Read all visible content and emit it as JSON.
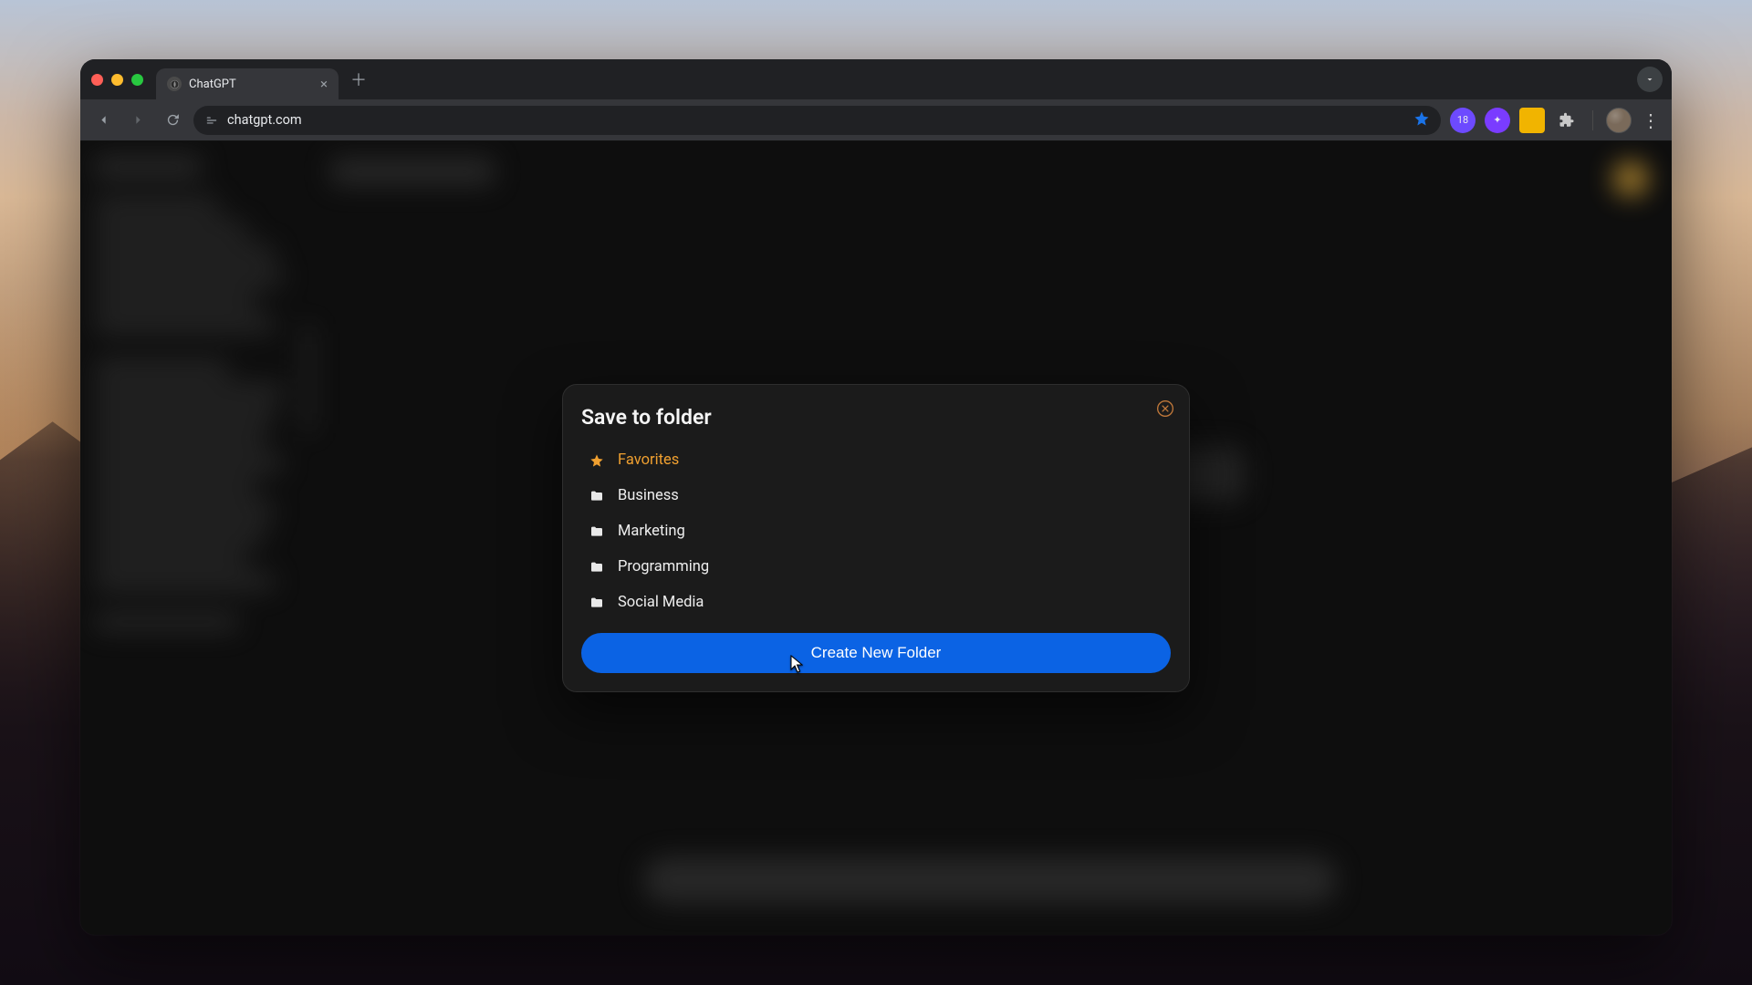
{
  "browser": {
    "tab_title": "ChatGPT",
    "url": "chatgpt.com",
    "extension_badge": "18"
  },
  "modal": {
    "title": "Save to folder",
    "folders": [
      {
        "label": "Favorites",
        "kind": "favorites"
      },
      {
        "label": "Business",
        "kind": "folder"
      },
      {
        "label": "Marketing",
        "kind": "folder"
      },
      {
        "label": "Programming",
        "kind": "folder"
      },
      {
        "label": "Social Media",
        "kind": "folder"
      }
    ],
    "create_label": "Create New Folder"
  },
  "colors": {
    "accent_orange": "#f0a030",
    "accent_blue": "#0b63e4"
  }
}
